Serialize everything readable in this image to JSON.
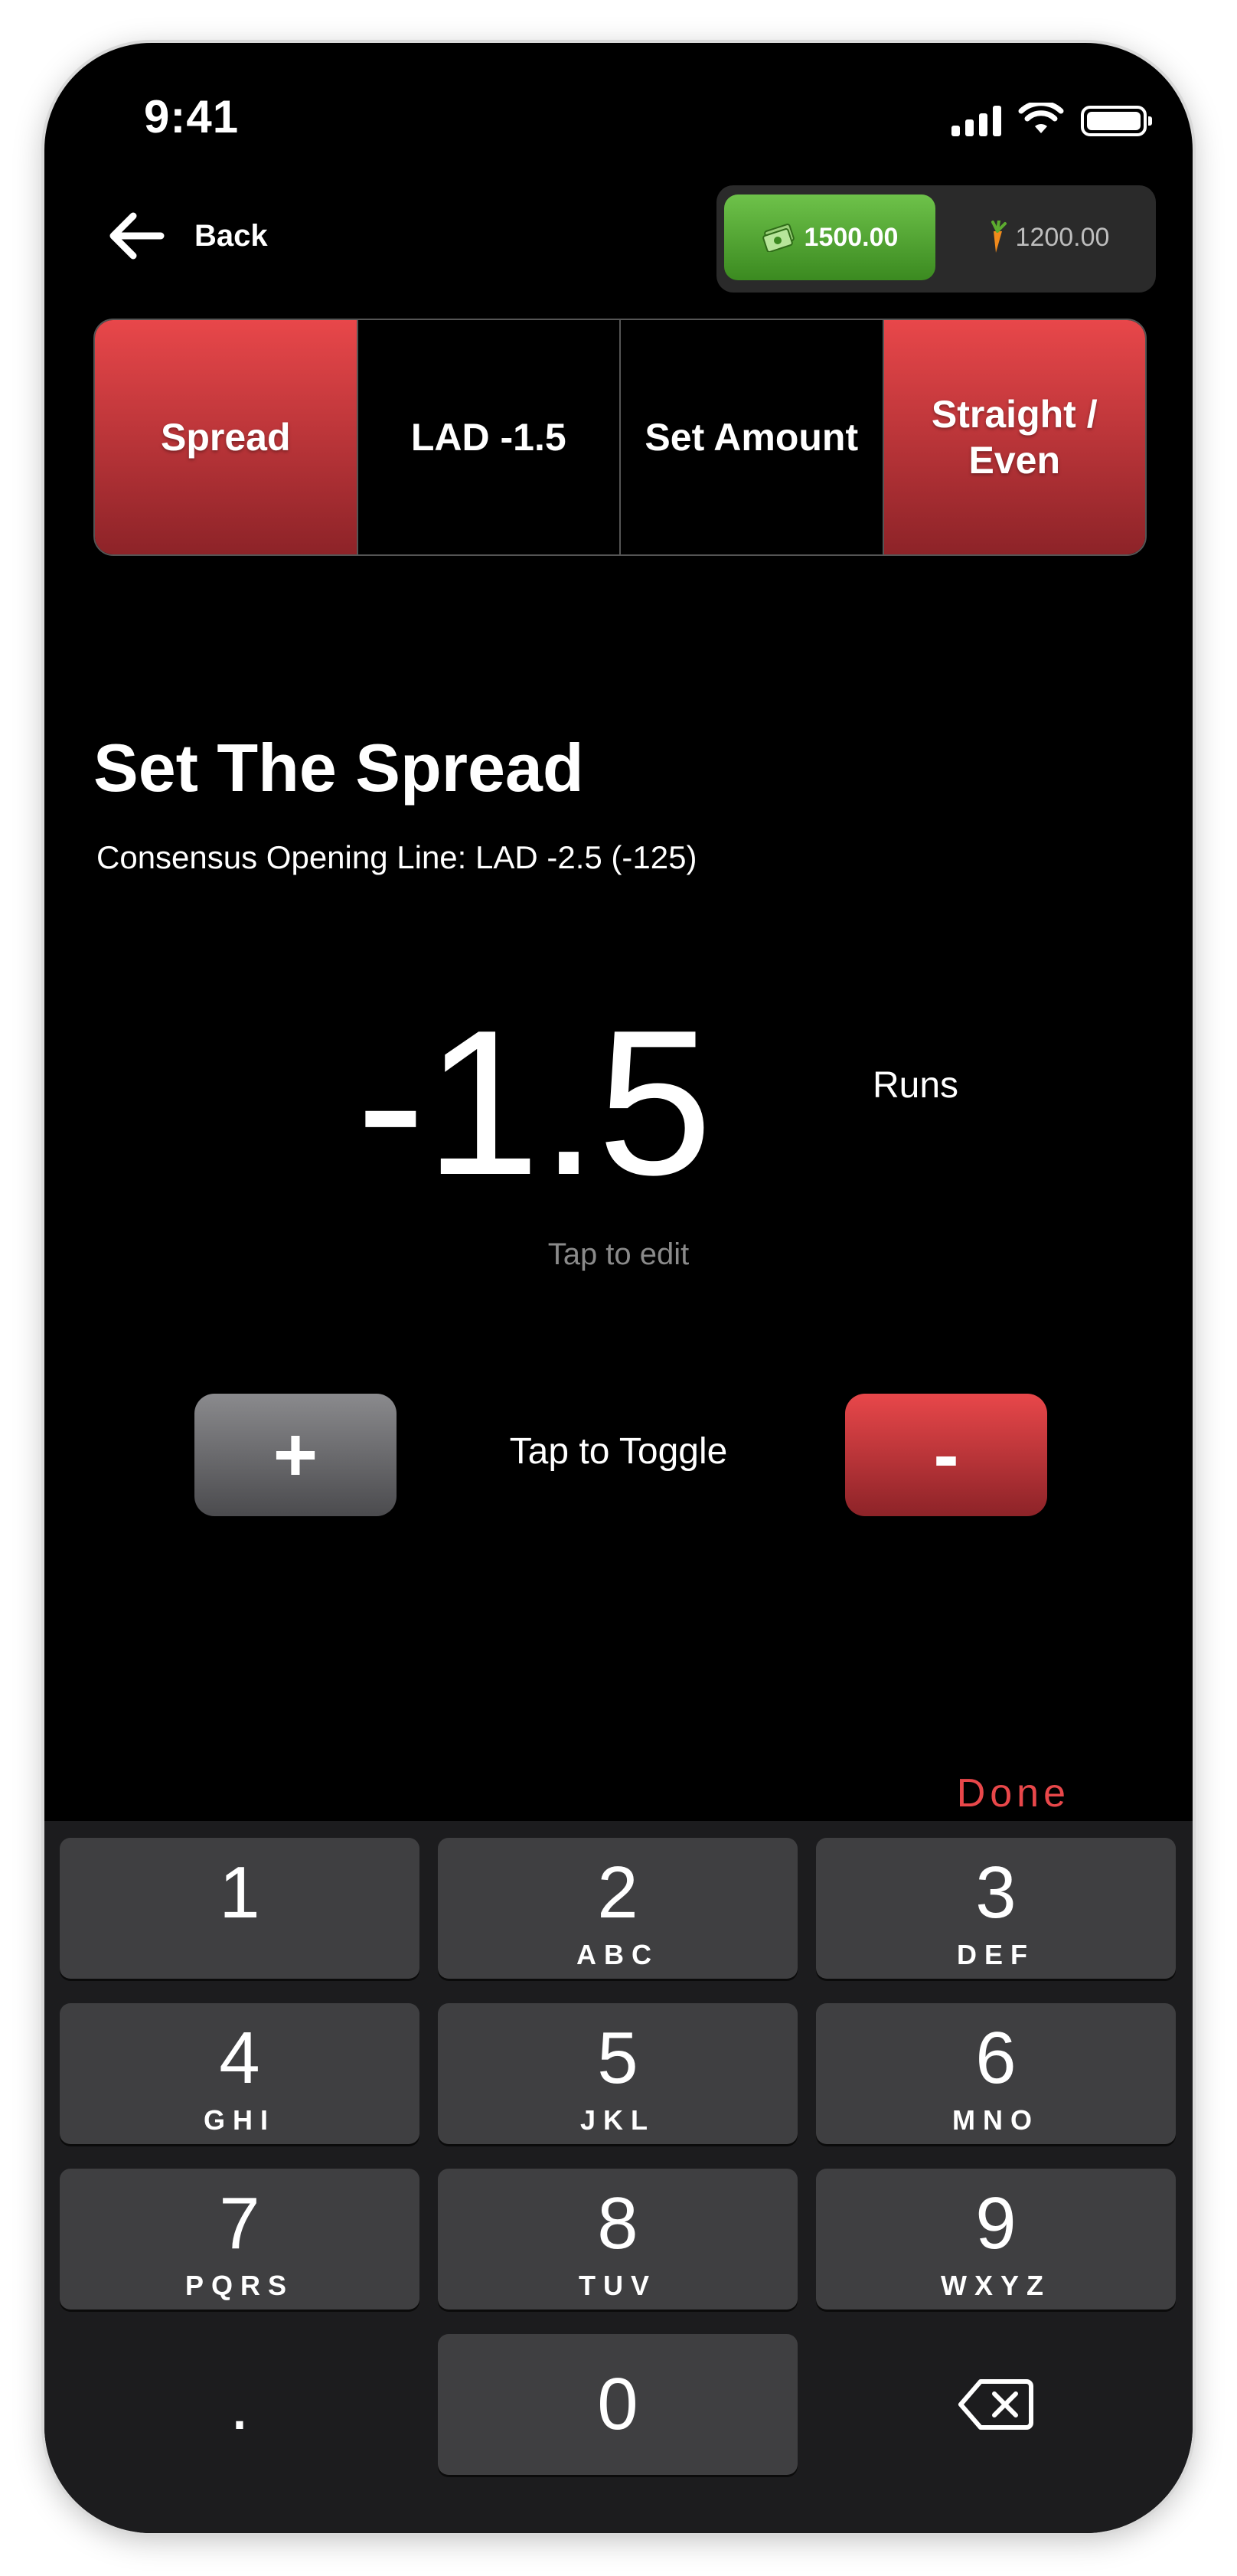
{
  "status_bar": {
    "time": "9:41"
  },
  "header": {
    "back_label": "Back",
    "balance_cash": "1500.00",
    "balance_coins": "1200.00"
  },
  "tabs": [
    {
      "label": "Spread",
      "active": true
    },
    {
      "label": "LAD -1.5",
      "active": false
    },
    {
      "label": "Set Amount",
      "active": false
    },
    {
      "label": "Straight / Even",
      "active": true
    }
  ],
  "main": {
    "title": "Set The Spread",
    "subtitle": "Consensus Opening Line: LAD -2.5 (-125)",
    "value": "-1.5",
    "unit": "Runs",
    "edit_hint": "Tap to edit",
    "plus_label": "+",
    "minus_label": "-",
    "toggle_label": "Tap to Toggle"
  },
  "keyboard": {
    "done_label": "Done",
    "keys": [
      {
        "num": "1",
        "letters": ""
      },
      {
        "num": "2",
        "letters": "ABC"
      },
      {
        "num": "3",
        "letters": "DEF"
      },
      {
        "num": "4",
        "letters": "GHI"
      },
      {
        "num": "5",
        "letters": "JKL"
      },
      {
        "num": "6",
        "letters": "MNO"
      },
      {
        "num": "7",
        "letters": "PQRS"
      },
      {
        "num": "8",
        "letters": "TUV"
      },
      {
        "num": "9",
        "letters": "WXYZ"
      },
      {
        "num": ".",
        "letters": ""
      },
      {
        "num": "0",
        "letters": ""
      }
    ]
  },
  "colors": {
    "accent_red": "#e8474a",
    "cash_green": "#5aa834",
    "background": "#000000"
  }
}
